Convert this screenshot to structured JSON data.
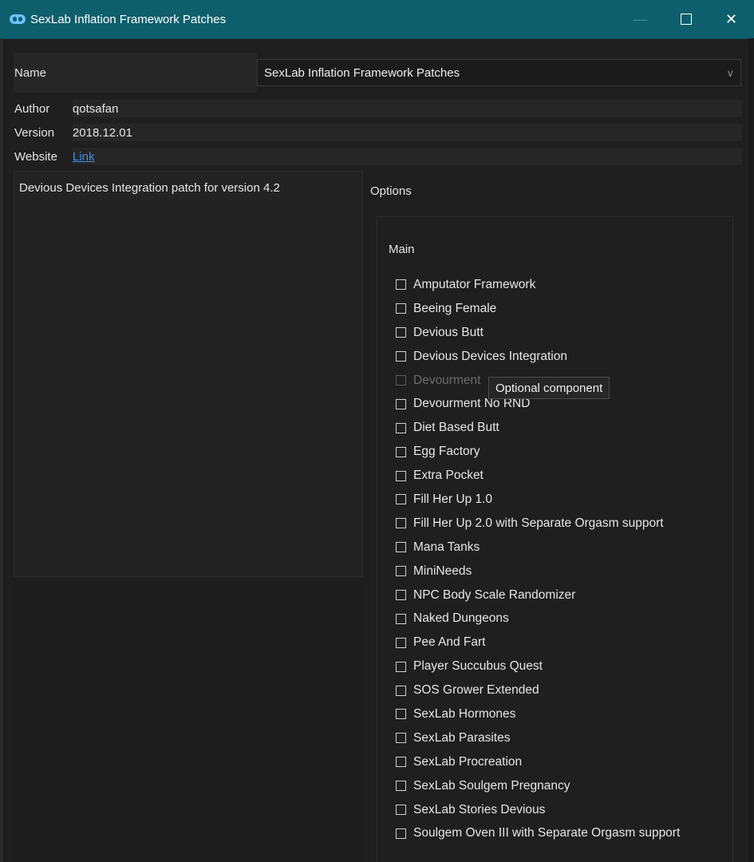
{
  "window": {
    "title": "SexLab Inflation Framework Patches",
    "buttons": {
      "minimize": "—",
      "close": "✕"
    }
  },
  "colors": {
    "titlebar": "#0e5f6c",
    "link": "#3b8ee8",
    "background": "#1f1f1f"
  },
  "fields": {
    "name_label": "Name",
    "name_value": "SexLab Inflation Framework Patches",
    "author_label": "Author",
    "author_value": "qotsafan",
    "version_label": "Version",
    "version_value": "2018.12.01",
    "website_label": "Website",
    "website_value": "Link"
  },
  "description": "Devious Devices Integration patch for version 4.2",
  "options": {
    "title": "Options",
    "group_title": "Main",
    "items": [
      "Amputator Framework",
      "Beeing Female",
      "Devious Butt",
      "Devious Devices Integration",
      "Devourment",
      "Devourment No RND",
      "Diet Based Butt",
      "Egg Factory",
      "Extra Pocket",
      "Fill Her Up 1.0",
      "Fill Her Up 2.0 with Separate Orgasm support",
      "Mana Tanks",
      "MiniNeeds",
      "NPC Body Scale Randomizer",
      "Naked Dungeons",
      "Pee And Fart",
      "Player Succubus Quest",
      "SOS Grower Extended",
      "SexLab Hormones",
      "SexLab Parasites",
      "SexLab Procreation",
      "SexLab Soulgem Pregnancy",
      "SexLab Stories Devious",
      "Soulgem Oven III with Separate Orgasm support"
    ]
  },
  "tooltip": "Optional component",
  "icons": {
    "app": "app-icon",
    "dropdown": "chevron-down-icon"
  }
}
